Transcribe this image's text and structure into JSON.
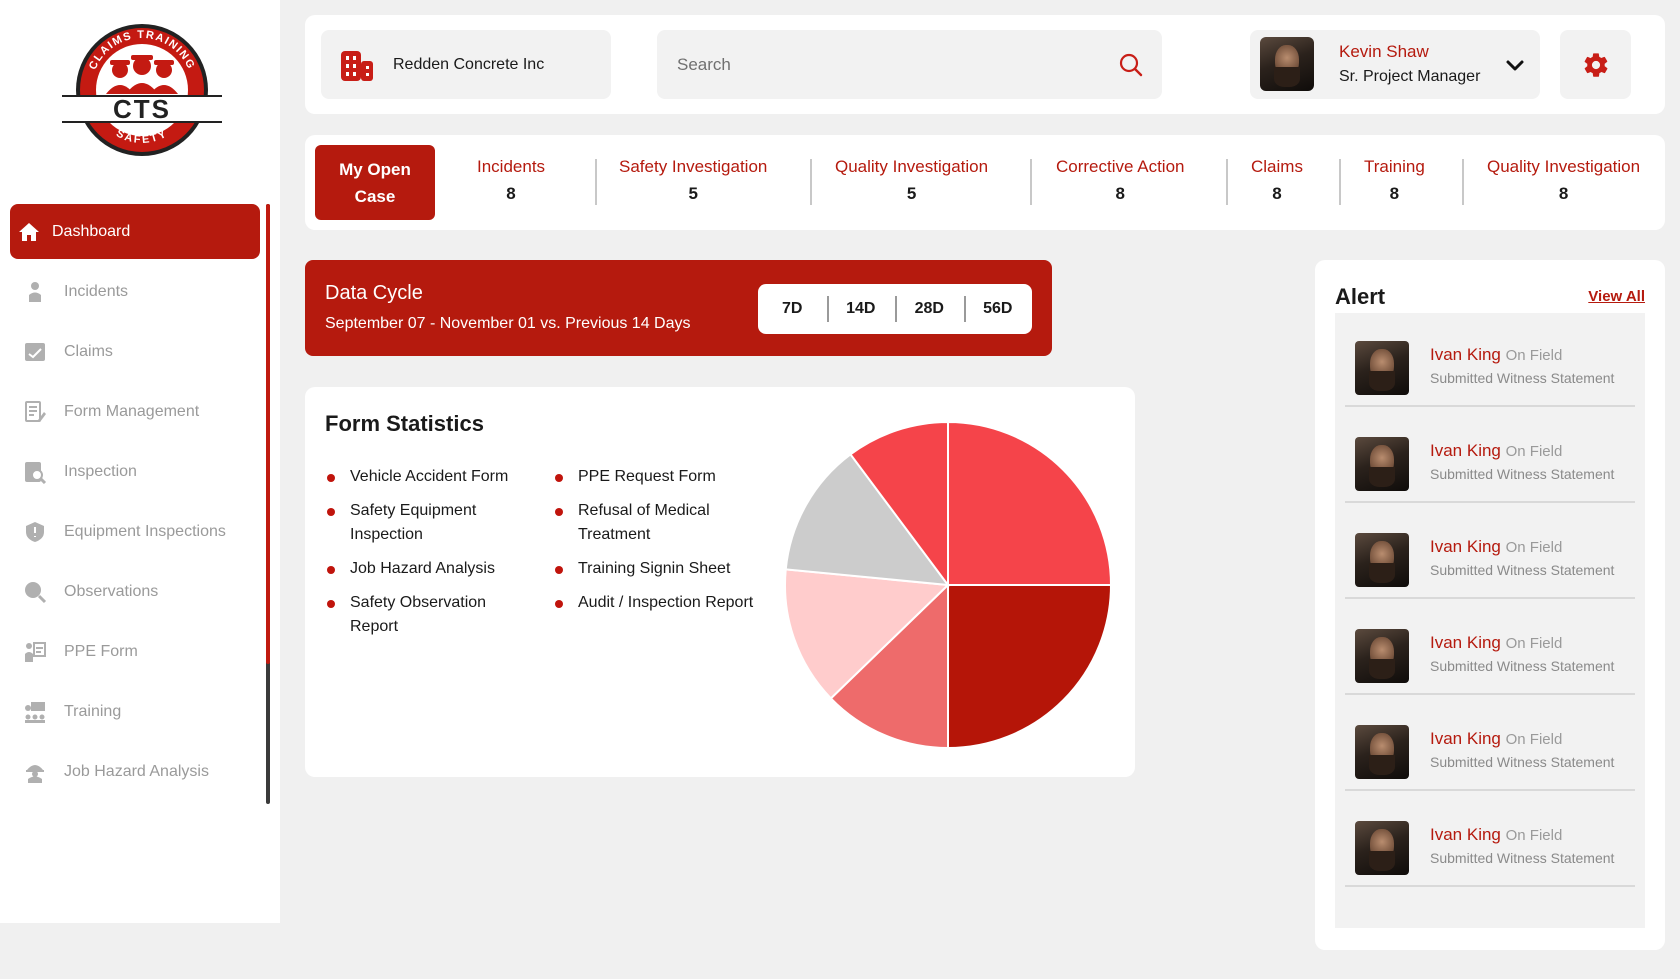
{
  "logo": {
    "arc_top": "CLAIMS TRAINING",
    "center": "CTS",
    "arc_bottom": "SAFETY"
  },
  "sidebar": {
    "items": [
      {
        "label": "Dashboard",
        "icon": "home-icon",
        "active": true
      },
      {
        "label": "Incidents",
        "icon": "worker-icon"
      },
      {
        "label": "Claims",
        "icon": "claims-icon"
      },
      {
        "label": "Form Management",
        "icon": "form-icon"
      },
      {
        "label": "Inspection",
        "icon": "inspection-icon"
      },
      {
        "label": "Equipment Inspections",
        "icon": "shield-icon"
      },
      {
        "label": "Observations",
        "icon": "magnifier-icon"
      },
      {
        "label": "PPE Form",
        "icon": "ppe-icon"
      },
      {
        "label": "Training",
        "icon": "training-icon"
      },
      {
        "label": "Job Hazard Analysis",
        "icon": "hardhat-icon"
      }
    ]
  },
  "header": {
    "company": "Redden Concrete Inc",
    "search_placeholder": "Search",
    "user_name": "Kevin Shaw",
    "user_role": "Sr. Project Manager"
  },
  "tabs": {
    "active": {
      "line1": "My Open",
      "line2": "Case"
    },
    "items": [
      {
        "label": "Incidents",
        "count": "8"
      },
      {
        "label": "Safety Investigation",
        "count": "5"
      },
      {
        "label": "Quality Investigation",
        "count": "5"
      },
      {
        "label": "Corrective Action",
        "count": "8"
      },
      {
        "label": "Claims",
        "count": "8"
      },
      {
        "label": "Training",
        "count": "8"
      },
      {
        "label": "Quality Investigation",
        "count": "8"
      }
    ]
  },
  "datacycle": {
    "title": "Data Cycle",
    "subtitle": "September 07 - November 01 vs. Previous 14 Days",
    "ranges": [
      "7D",
      "14D",
      "28D",
      "56D"
    ]
  },
  "form_statistics": {
    "title": "Form Statistics",
    "legend_col1": [
      "Vehicle Accident Form",
      "Safety Equipment Inspection",
      "Job Hazard Analysis",
      "Safety Observation Report"
    ],
    "legend_col2": [
      "PPE Request Form",
      "Refusal of Medical Treatment",
      "Training Signin Sheet",
      "Audit / Inspection Report"
    ]
  },
  "chart_data": {
    "type": "pie",
    "values": [
      24.5,
      24.5,
      12.5,
      13.5,
      13,
      10
    ],
    "colors": [
      "#f5444a",
      "#b51508",
      "#ee6b6b",
      "#ffcccc",
      "#cccccc",
      "#f5444a"
    ]
  },
  "alert": {
    "title": "Alert",
    "view_all": "View All",
    "items": [
      {
        "name": "Ivan King",
        "status": "On Field",
        "desc": "Submitted Witness Statement"
      },
      {
        "name": "Ivan King",
        "status": "On Field",
        "desc": "Submitted Witness Statement"
      },
      {
        "name": "Ivan King",
        "status": "On Field",
        "desc": "Submitted Witness Statement"
      },
      {
        "name": "Ivan King",
        "status": "On Field",
        "desc": "Submitted Witness Statement"
      },
      {
        "name": "Ivan King",
        "status": "On Field",
        "desc": "Submitted Witness Statement"
      },
      {
        "name": "Ivan King",
        "status": "On Field",
        "desc": "Submitted Witness Statement"
      }
    ]
  },
  "colors": {
    "brand": "#b51a0e",
    "background": "#f0f0f0",
    "panel": "#ffffff",
    "muted": "#9a9a9a"
  }
}
